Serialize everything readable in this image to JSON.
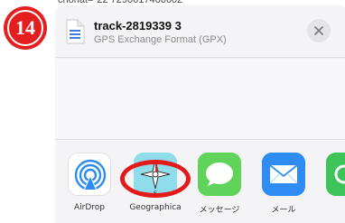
{
  "background": {
    "partial_text": "chorlat=\"22 7290617466602\""
  },
  "step_badge": {
    "label": "⑭",
    "color": "#e41e1e"
  },
  "share_sheet": {
    "file_name": "track-2819339 3",
    "file_type": "GPS Exchange Format (GPX)",
    "close_icon": "close-icon"
  },
  "apps": [
    {
      "label": "AirDrop",
      "icon": "airdrop-icon"
    },
    {
      "label": "Geographica",
      "icon": "compass-icon"
    },
    {
      "label": "メッセージ",
      "icon": "messages-icon"
    },
    {
      "label": "メール",
      "icon": "mail-icon"
    }
  ],
  "highlight": {
    "target": "Geographica",
    "color": "#e21a1a"
  }
}
